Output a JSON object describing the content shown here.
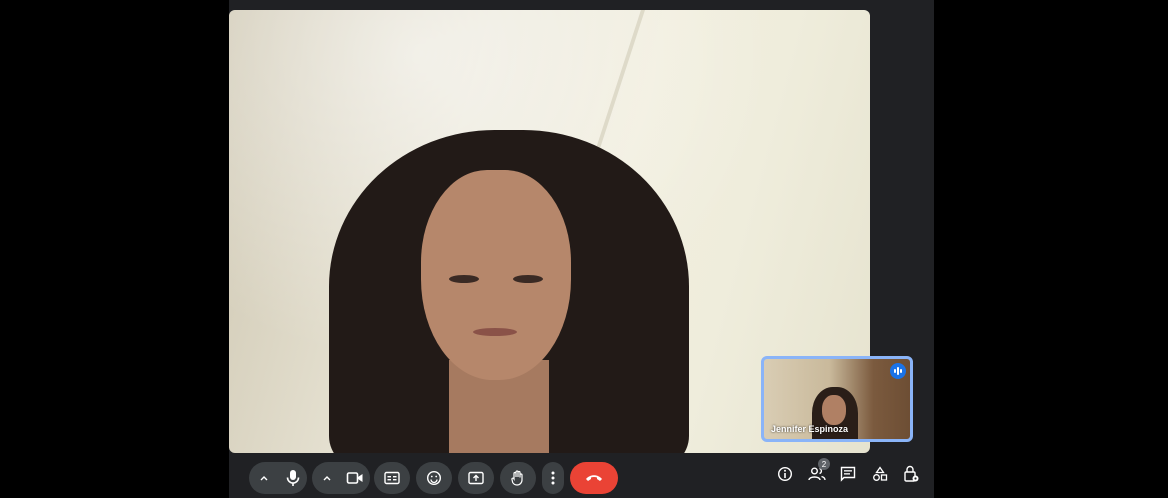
{
  "participant": {
    "self_name": "Jennifer Espinoza",
    "count_badge": "2"
  },
  "colors": {
    "background": "#202124",
    "button": "#3c4043",
    "hangup": "#ea4335",
    "pip_border": "#8ab4f8",
    "speaking_indicator": "#1a73e8"
  },
  "controls": [
    {
      "name": "mic-options-chevron-icon"
    },
    {
      "name": "microphone-icon"
    },
    {
      "name": "camera-options-chevron-icon"
    },
    {
      "name": "camera-icon"
    },
    {
      "name": "captions-icon"
    },
    {
      "name": "emoji-icon"
    },
    {
      "name": "present-screen-icon"
    },
    {
      "name": "raise-hand-icon"
    },
    {
      "name": "more-options-icon"
    },
    {
      "name": "hang-up-icon"
    },
    {
      "name": "meeting-details-icon"
    },
    {
      "name": "people-icon"
    },
    {
      "name": "chat-icon"
    },
    {
      "name": "activities-icon"
    },
    {
      "name": "host-controls-icon"
    }
  ]
}
